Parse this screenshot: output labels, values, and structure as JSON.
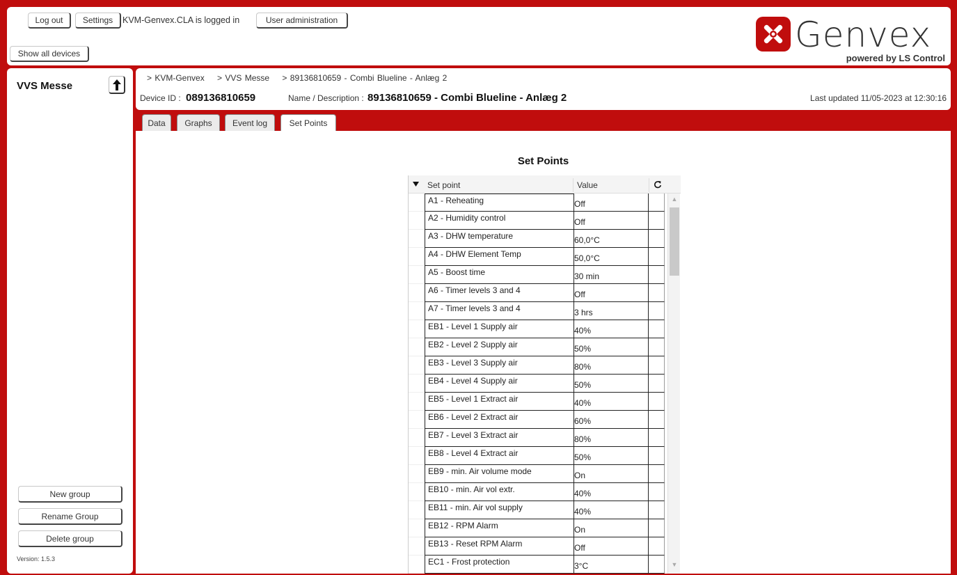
{
  "header": {
    "logout_label": "Log out",
    "settings_label": "Settings",
    "logged_in_text": "KVM-Genvex.CLA is logged in",
    "user_admin_label": "User administration",
    "show_all_label": "Show all devices",
    "logo_text": "Genvex",
    "logo_sub": "powered by LS Control",
    "brand_color": "#c00d0d"
  },
  "sidebar": {
    "group_title": "VVS Messe",
    "up_icon": "arrow-up-icon",
    "new_group_label": "New group",
    "rename_group_label": "Rename Group",
    "delete_group_label": "Delete group",
    "version": "Version: 1.5.3"
  },
  "device": {
    "breadcrumbs": [
      "> KVM-Genvex",
      "> VVS Messe",
      "> 89136810659 - Combi Blueline - Anlæg 2"
    ],
    "id_label": "Device ID :",
    "id_value": "089136810659",
    "name_label": "Name / Description :",
    "name_value": "89136810659 - Combi Blueline - Anlæg 2",
    "last_updated": "Last updated 11/05-2023 at 12:30:16"
  },
  "tabs": [
    {
      "label": "Data"
    },
    {
      "label": "Graphs"
    },
    {
      "label": "Event log"
    },
    {
      "label": "Set Points",
      "active": true
    }
  ],
  "setpoints": {
    "title": "Set Points",
    "col_setpoint": "Set point",
    "col_value": "Value",
    "sort_icon": "sort-down-icon",
    "refresh_icon": "refresh-icon",
    "rows": [
      {
        "name": "A1 - Reheating",
        "value": "Off"
      },
      {
        "name": "A2 - Humidity control",
        "value": "Off"
      },
      {
        "name": "A3 - DHW temperature",
        "value": "60,0°C"
      },
      {
        "name": "A4 - DHW Element Temp",
        "value": "50,0°C"
      },
      {
        "name": "A5 - Boost time",
        "value": "30 min"
      },
      {
        "name": "A6 - Timer levels 3 and 4",
        "value": "Off"
      },
      {
        "name": "A7 - Timer levels 3 and 4",
        "value": "3 hrs"
      },
      {
        "name": "EB1 - Level 1 Supply air",
        "value": "40%"
      },
      {
        "name": "EB2 - Level 2 Supply air",
        "value": "50%"
      },
      {
        "name": "EB3 - Level 3 Supply air",
        "value": "80%"
      },
      {
        "name": "EB4 - Level 4 Supply air",
        "value": "50%"
      },
      {
        "name": "EB5 - Level 1 Extract air",
        "value": "40%"
      },
      {
        "name": "EB6 - Level 2 Extract air",
        "value": "60%"
      },
      {
        "name": "EB7 - Level 3 Extract air",
        "value": "80%"
      },
      {
        "name": "EB8 - Level 4 Extract air",
        "value": "50%"
      },
      {
        "name": "EB9 - min. Air volume mode",
        "value": "On"
      },
      {
        "name": "EB10 - min. Air vol extr.",
        "value": "40%"
      },
      {
        "name": "EB11 - min. Air vol supply",
        "value": "40%"
      },
      {
        "name": "EB12 - RPM Alarm",
        "value": "On"
      },
      {
        "name": "EB13 - Reset RPM Alarm",
        "value": "Off"
      },
      {
        "name": "EC1 - Frost protection",
        "value": "3°C"
      }
    ]
  }
}
